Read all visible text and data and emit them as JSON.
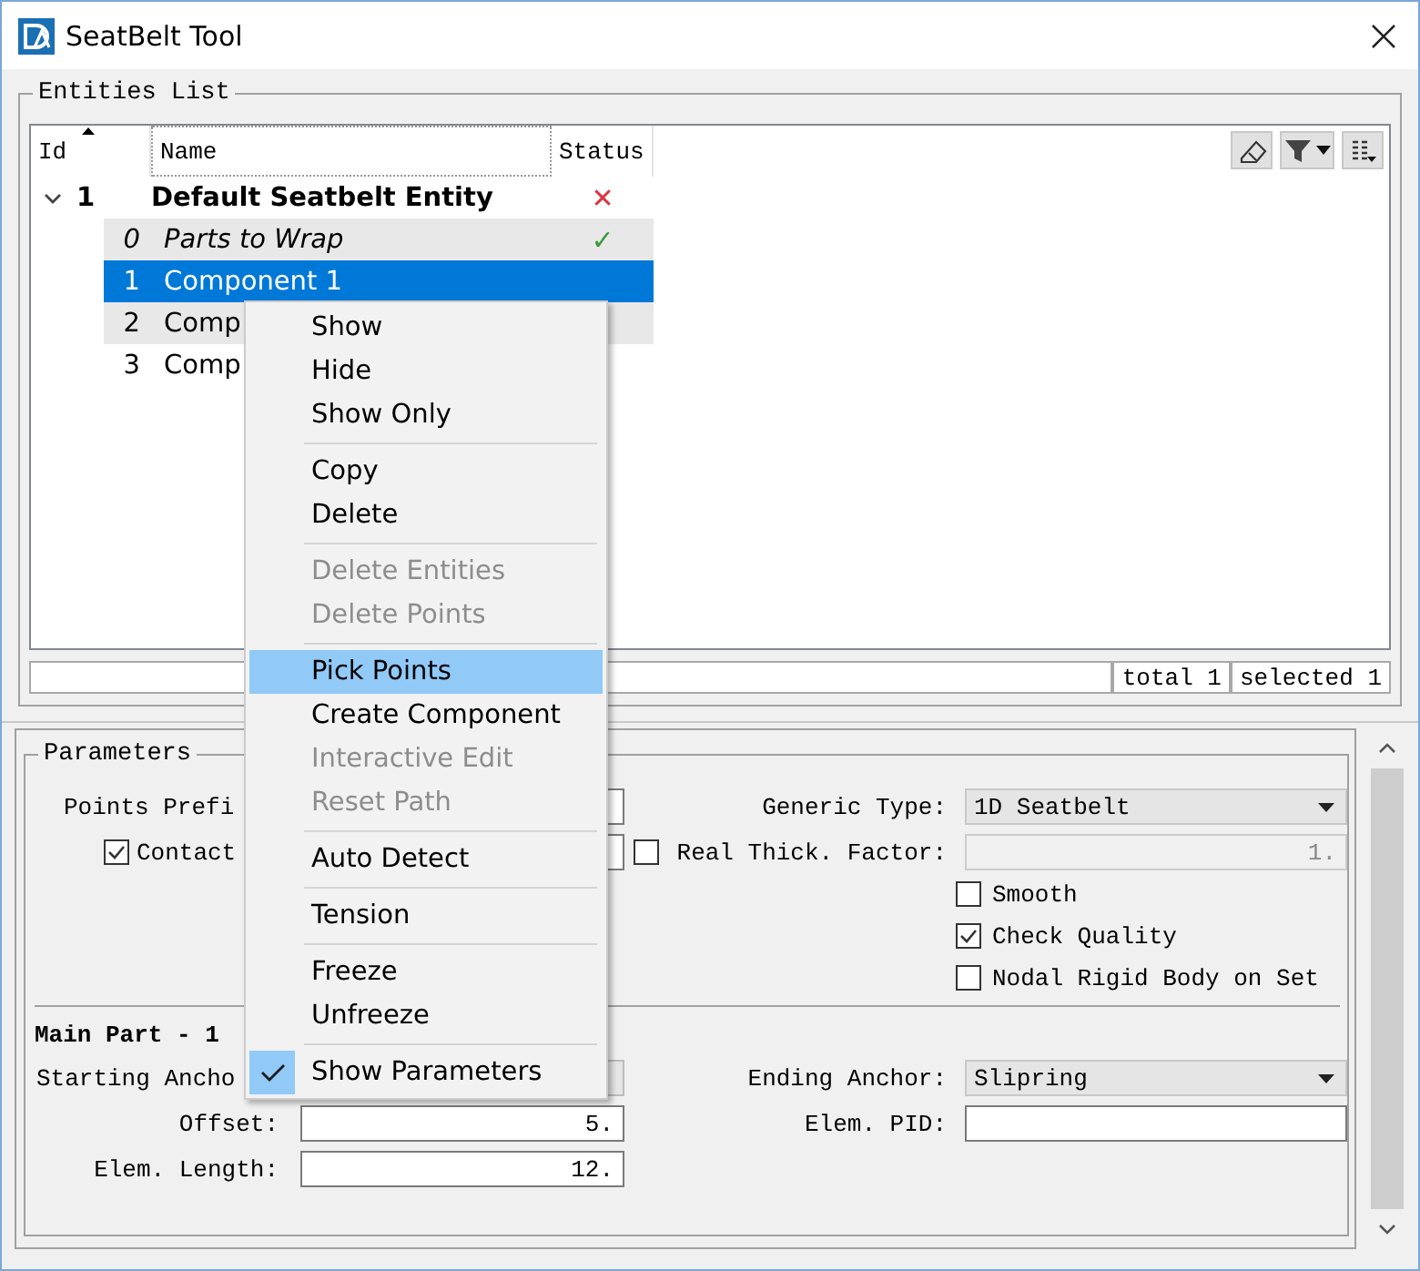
{
  "window": {
    "title": "SeatBelt Tool"
  },
  "entities_list": {
    "title": "Entities List",
    "columns": [
      "Id",
      "Name",
      "Status"
    ],
    "tree": [
      {
        "id": "1",
        "name": "Default Seatbelt Entity",
        "status": "✕",
        "color": "#d9363e",
        "expanded": true,
        "children": [
          {
            "id": "0",
            "name": "Parts to Wrap",
            "kind": "parts",
            "status": "✓",
            "color": "#3a9a3a",
            "selected": false
          },
          {
            "id": "1",
            "name": "Component 1",
            "kind": "component",
            "selected": true
          },
          {
            "id": "2",
            "name": "Comp",
            "kind": "component",
            "selected": false
          },
          {
            "id": "3",
            "name": "Comp",
            "kind": "component",
            "selected": false
          }
        ]
      }
    ],
    "status_bar": {
      "total": "total 1",
      "selected": "selected 1"
    }
  },
  "parameters": {
    "title": "Parameters",
    "points_prefix": {
      "label": "Points Prefi"
    },
    "contact": {
      "label": "Contact",
      "checked": true
    },
    "generic_type": {
      "label": "Generic Type:",
      "value": "1D Seatbelt"
    },
    "real_thick": {
      "label": "Real Thick. Factor:",
      "checked": false,
      "value": "1.",
      "disabled": true
    },
    "options": [
      {
        "label": "Smooth",
        "checked": false
      },
      {
        "label": "Check Quality",
        "checked": true
      },
      {
        "label": "Nodal Rigid Body on Set",
        "checked": false
      }
    ],
    "main_part": {
      "title": "Main Part - 1",
      "starting_anchor": {
        "label": "Starting Ancho"
      },
      "ending_anchor": {
        "label": "Ending Anchor:",
        "value": "Slipring"
      },
      "offset": {
        "label": "Offset:",
        "value": "5."
      },
      "elem_pid": {
        "label": "Elem. PID:"
      },
      "elem_length": {
        "label": "Elem. Length:",
        "value": "12."
      }
    }
  },
  "context_menu": {
    "groups": [
      [
        {
          "label": "Show",
          "disabled": false,
          "selected": false,
          "checked": false
        },
        {
          "label": "Hide",
          "disabled": false,
          "selected": false,
          "checked": false
        },
        {
          "label": "Show Only",
          "disabled": false,
          "selected": false,
          "checked": false
        }
      ],
      [
        {
          "label": "Copy",
          "disabled": false,
          "selected": false,
          "checked": false
        },
        {
          "label": "Delete",
          "disabled": false,
          "selected": false,
          "checked": false
        }
      ],
      [
        {
          "label": "Delete Entities",
          "disabled": true,
          "selected": false,
          "checked": false
        },
        {
          "label": "Delete Points",
          "disabled": true,
          "selected": false,
          "checked": false
        }
      ],
      [
        {
          "label": "Pick Points",
          "disabled": false,
          "selected": true,
          "checked": false
        },
        {
          "label": "Create Component",
          "disabled": false,
          "selected": false,
          "checked": false
        },
        {
          "label": "Interactive Edit",
          "disabled": true,
          "selected": false,
          "checked": false
        },
        {
          "label": "Reset Path",
          "disabled": true,
          "selected": false,
          "checked": false
        }
      ],
      [
        {
          "label": "Auto Detect",
          "disabled": false,
          "selected": false,
          "checked": false
        }
      ],
      [
        {
          "label": "Tension",
          "disabled": false,
          "selected": false,
          "checked": false
        }
      ],
      [
        {
          "label": "Freeze",
          "disabled": false,
          "selected": false,
          "checked": false
        },
        {
          "label": "Unfreeze",
          "disabled": false,
          "selected": false,
          "checked": false
        }
      ],
      [
        {
          "label": "Show Parameters",
          "disabled": false,
          "selected": false,
          "checked": true
        }
      ]
    ]
  }
}
